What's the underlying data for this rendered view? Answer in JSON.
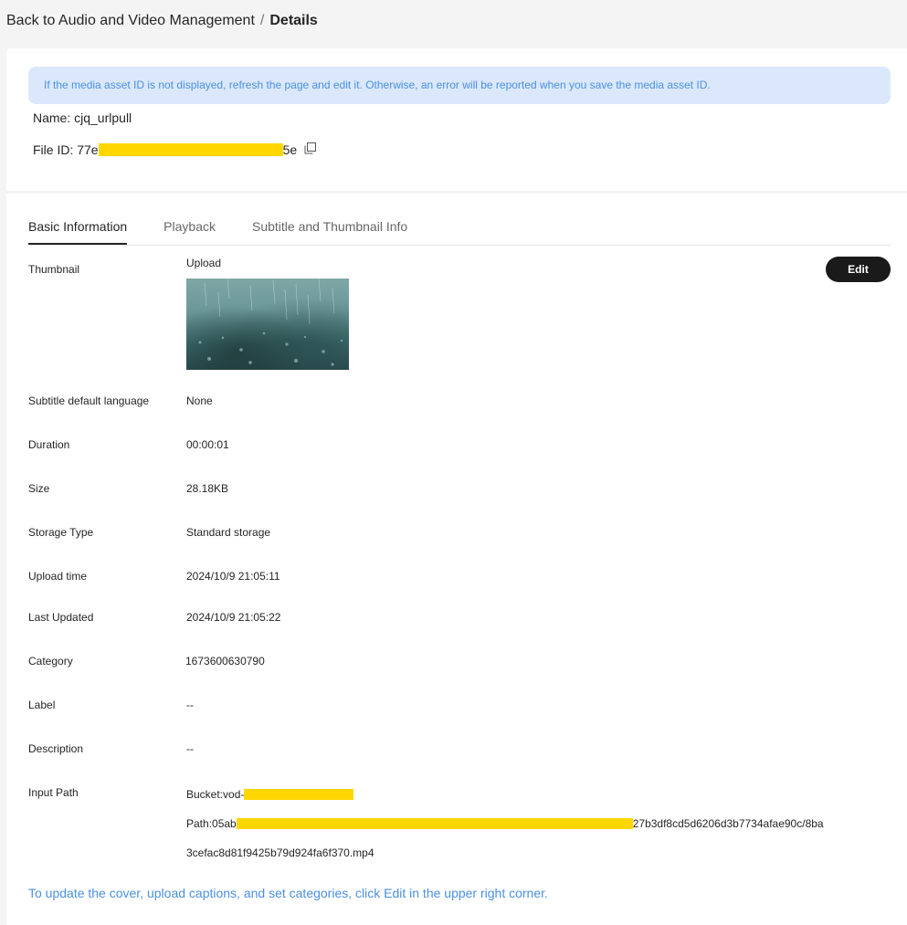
{
  "breadcrumb": {
    "back_label": "Back to Audio and Video Management",
    "separator": "/",
    "current": "Details"
  },
  "notice": "If the media asset ID is not displayed, refresh the page and edit it. Otherwise, an error will be reported when you save the media asset ID.",
  "asset": {
    "name_line": "Name: cjq_urlpull",
    "file_id_prefix": "File ID: 77e",
    "file_id_suffix": "5e"
  },
  "tabs": [
    "Basic Information",
    "Playback",
    "Subtitle and Thumbnail Info"
  ],
  "edit_label": "Edit",
  "details": {
    "thumbnail_label": "Thumbnail",
    "thumbnail_value": "Upload",
    "subtitle_label": "Subtitle default language",
    "subtitle_value": "None",
    "duration_label": "Duration",
    "duration_value": "00:00:01",
    "size_label": "Size",
    "size_value": "28.18KB",
    "storage_label": "Storage Type",
    "storage_value": "Standard storage",
    "upload_label": "Upload time",
    "upload_value": "2024/10/9 21:05:11",
    "updated_label": "Last Updated",
    "updated_value": "2024/10/9 21:05:22",
    "category_label": "Category",
    "category_value": "1673600630790",
    "label_label": "Label",
    "label_value": "--",
    "description_label": "Description",
    "description_value": "--",
    "input_path_label": "Input Path",
    "bucket_prefix": "Bucket:vod-",
    "path_prefix": "Path:05ab",
    "path_suffix": "27b3df8cd5d6206d3b7734afae90c/8ba",
    "path_line2": "3cefac8d81f9425b79d924fa6f370.mp4"
  },
  "footer_hint": "To update the cover, upload captions, and set categories, click Edit in the upper right corner.",
  "colors": {
    "accent_blue": "#4a90e2",
    "notice_bg": "#dbe8fb",
    "redaction": "#ffd700",
    "button_dark": "#1a1a1a"
  }
}
